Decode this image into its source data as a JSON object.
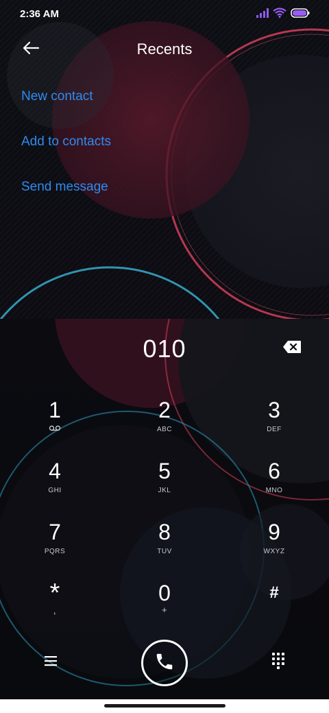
{
  "status_bar": {
    "time": "2:36 AM",
    "icons": [
      "signal-icon",
      "wifi-icon",
      "battery-icon"
    ],
    "accent_color": "#9b5cf6"
  },
  "header": {
    "title": "Recents",
    "back_icon": "arrow-left-icon"
  },
  "actions": {
    "new_contact": "New contact",
    "add_to_contacts": "Add to contacts",
    "send_message": "Send message",
    "link_color": "#2f8bf0"
  },
  "dialer": {
    "number": "010",
    "backspace_icon": "backspace-icon"
  },
  "keypad": [
    {
      "digit": "1",
      "sub": "",
      "sub_icon": "voicemail-icon"
    },
    {
      "digit": "2",
      "sub": "ABC"
    },
    {
      "digit": "3",
      "sub": "DEF"
    },
    {
      "digit": "4",
      "sub": "GHI"
    },
    {
      "digit": "5",
      "sub": "JKL"
    },
    {
      "digit": "6",
      "sub": "MNO"
    },
    {
      "digit": "7",
      "sub": "PQRS"
    },
    {
      "digit": "8",
      "sub": "TUV"
    },
    {
      "digit": "9",
      "sub": "WXYZ"
    },
    {
      "digit": "*",
      "sub": ","
    },
    {
      "digit": "0",
      "sub": "+"
    },
    {
      "digit": "#",
      "sub": ""
    }
  ],
  "bottom_bar": {
    "menu_icon": "menu-icon",
    "call_icon": "phone-icon",
    "keypad_icon": "dialpad-icon"
  }
}
